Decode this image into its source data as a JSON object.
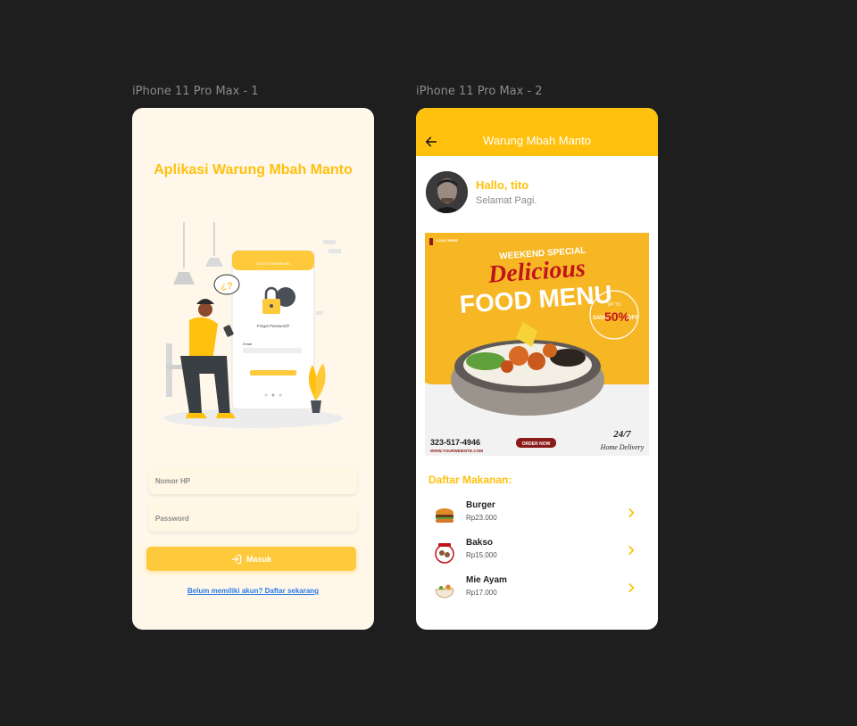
{
  "frames": {
    "one_label": "iPhone 11 Pro Max - 1",
    "two_label": "iPhone 11 Pro Max - 2"
  },
  "login": {
    "title": "Aplikasi Warung Mbah Manto",
    "phone_placeholder": "Nomor HP",
    "password_placeholder": "Password",
    "submit_label": "Masuk",
    "register_link": "Belum memiliki akun? Daftar sekarang",
    "illustration": {
      "screen_title": "FOGOT PASSWORD",
      "forgot_text": "Forgot Password?",
      "email_label": "Email"
    }
  },
  "home": {
    "appbar_title": "Warung Mbah Manto",
    "greeting": "Hallo, tito",
    "subgreeting": "Selamat Pagi.",
    "banner": {
      "logo_text": "LOGO HERE",
      "tagline": "WEEKEND SPECIAL",
      "headline_1": "Delicious",
      "headline_2": "FOOD MENU",
      "promo_top": "UP TO",
      "promo_save": "SAVE",
      "promo_value": "50%",
      "promo_off": "OFF",
      "phone": "323-517-4946",
      "website": "WWW.YOURWEBSITE.COM",
      "order_label": "ORDER NOW",
      "hours": "24/7",
      "delivery": "Home Delivery"
    },
    "section_title": "Daftar Makanan:",
    "menu": [
      {
        "name": "Burger",
        "price": "Rp23.000"
      },
      {
        "name": "Bakso",
        "price": "Rp15.000"
      },
      {
        "name": "Mie Ayam",
        "price": "Rp17.000"
      }
    ]
  },
  "colors": {
    "accent": "#ffc10e",
    "button": "#ffc93c",
    "login_bg": "#fff8ea",
    "link": "#2a7be4"
  }
}
